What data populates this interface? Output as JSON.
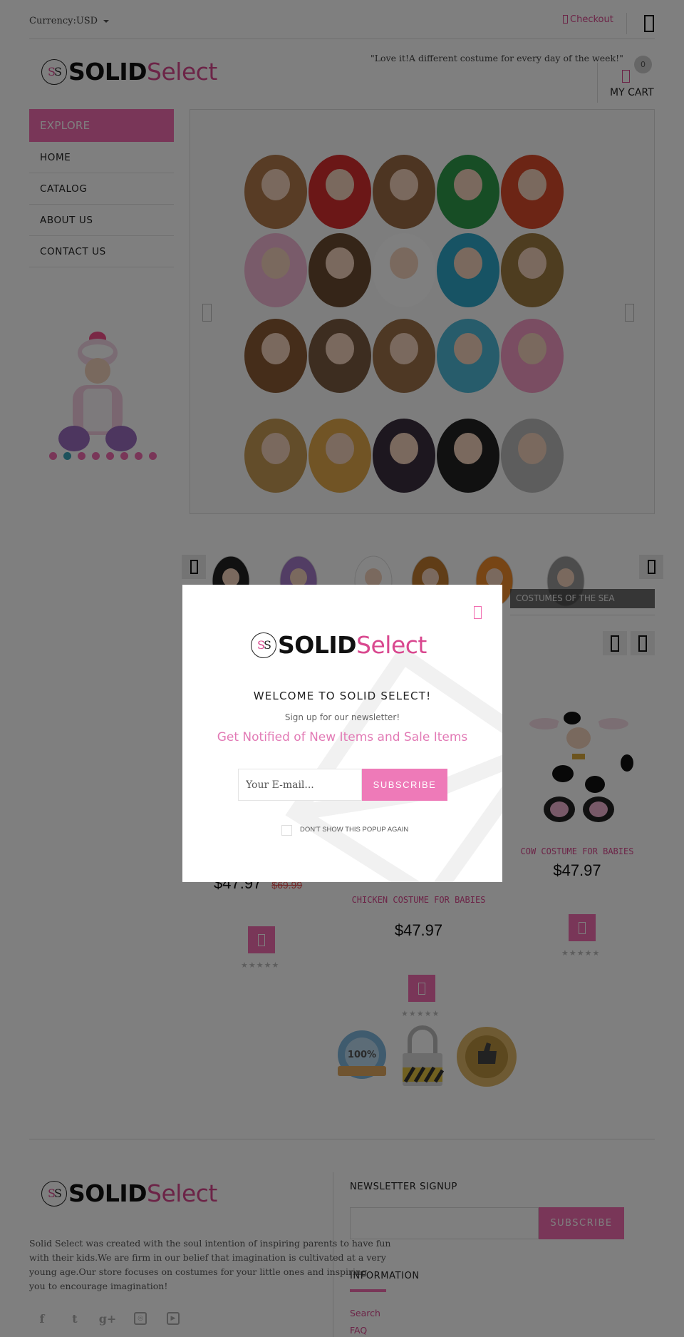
{
  "topbar": {
    "currency_label": "Currency:USD",
    "checkout_label": "Checkout"
  },
  "brand": {
    "badge": "SS",
    "solid": "SOLID",
    "select": "Select",
    "accent_color": "#f26db0"
  },
  "header": {
    "tagline": "\"Love it!A different costume for every day of the week!\"",
    "cart_count": "0",
    "cart_label": "MY CART"
  },
  "sidebar": {
    "title": "EXPLORE",
    "items": [
      {
        "label": "HOME"
      },
      {
        "label": "CATALOG"
      },
      {
        "label": "ABOUT US"
      },
      {
        "label": "CONTACT US"
      }
    ],
    "slider_dots": 8,
    "slider_active_index": 1
  },
  "categories": {
    "caption": "COSTUMES OF THE SEA"
  },
  "products": [
    {
      "name": "",
      "price": "$47.97",
      "old_price": "$69.99",
      "rating": 0
    },
    {
      "name": "CHICKEN COSTUME FOR BABIES",
      "price": "$47.97",
      "rating": 0
    },
    {
      "name": "COW COSTUME FOR BABIES",
      "price": "$47.97",
      "rating": 0
    }
  ],
  "footer": {
    "about": "Solid Select was created with the soul intention of inspiring parents to have fun with their kids. We are firm in our belief that imagination is cultivated at a very young age. Our store focuses on costumes for your little ones and inspiring you to encourage imagination!",
    "about_lines": [
      "Solid Select was created with the soul intention of inspiring parents to have fun",
      "with their kids.We are firm in our belief that imagination is cultivated at a very",
      "young age.Our store focuses on costumes for your little ones and inspiring",
      "you to encourage imagination!"
    ],
    "socials": [
      "facebook",
      "twitter",
      "google-plus",
      "instagram",
      "youtube"
    ],
    "newsletter_title": "NEWSLETTER SIGNUP",
    "newsletter_button": "SUBSCRIBE",
    "info_title": "INFORMATION",
    "links": [
      "Search",
      "FAQ"
    ]
  },
  "modal": {
    "title": "WELCOME TO SOLID SELECT!",
    "subtitle": "Sign up for our newsletter!",
    "notify": "Get Notified of New Items and Sale Items",
    "email_placeholder": "Your E-mail...",
    "subscribe_label": "SUBSCRIBE",
    "dont_show_label": "DON'T SHOW THIS POPUP AGAIN",
    "dont_show_checked": false
  }
}
